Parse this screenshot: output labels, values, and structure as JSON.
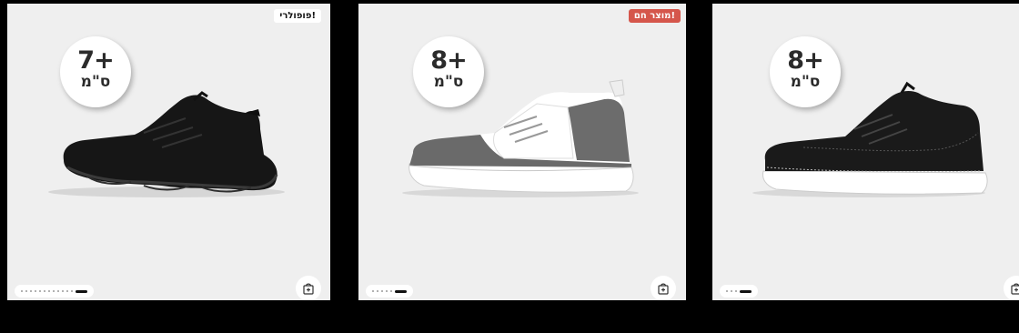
{
  "colors": {
    "page_background": "#000000",
    "card_background": "#efefef",
    "hot_tag_background": "#d5564b",
    "popular_tag_background": "#ffffff"
  },
  "products": [
    {
      "height_value": "7+",
      "height_unit": "ס\"מ",
      "tag": "פופולרי!",
      "tag_style": "popular",
      "image_icon": "black-chunky-sneaker",
      "gallery_total": 13,
      "gallery_active_index": 13,
      "cart_icon": "add-to-bag-icon"
    },
    {
      "height_value": "8+",
      "height_unit": "ס\"מ",
      "tag": "מוצר חם!",
      "tag_style": "hot",
      "image_icon": "grey-white-suede-sneaker",
      "gallery_total": 6,
      "gallery_active_index": 6,
      "cart_icon": "add-to-bag-icon"
    },
    {
      "height_value": "8+",
      "height_unit": "ס\"מ",
      "tag": "",
      "tag_style": "none",
      "image_icon": "black-leather-sneaker",
      "gallery_total": 4,
      "gallery_active_index": 4,
      "cart_icon": "add-to-bag-icon"
    }
  ]
}
